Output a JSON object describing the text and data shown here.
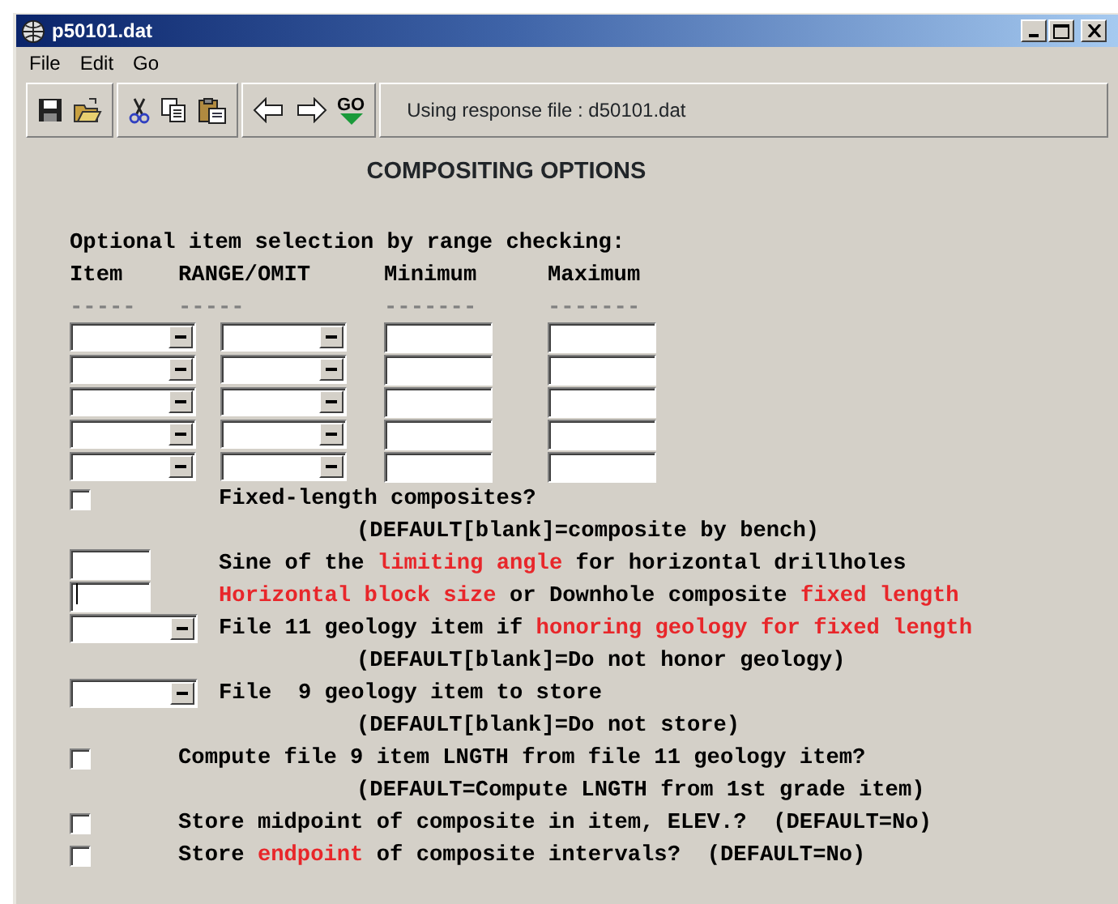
{
  "window": {
    "title": "p50101.dat"
  },
  "menu": [
    {
      "label": "File"
    },
    {
      "label": "Edit"
    },
    {
      "label": "Go"
    }
  ],
  "toolbar": {
    "go_label": "GO",
    "status": "Using response file : d50101.dat"
  },
  "heading": "COMPOSITING OPTIONS",
  "range_section": {
    "title": "Optional item selection by range checking:",
    "columns": [
      {
        "label": "Item",
        "rule": "-----",
        "kind": "dropdown"
      },
      {
        "label": "RANGE/OMIT",
        "rule": "-----",
        "kind": "dropdown"
      },
      {
        "label": "Minimum",
        "rule": "-------",
        "kind": "textbox"
      },
      {
        "label": "Maximum",
        "rule": "-------",
        "kind": "textbox"
      }
    ],
    "rows": [
      {
        "kind": "blank"
      },
      {
        "kind": "blank"
      },
      {
        "kind": "blank"
      },
      {
        "kind": "blank"
      },
      {
        "kind": "blank"
      }
    ]
  },
  "options": [
    {
      "kind": "toggle",
      "checked": false,
      "label": [
        {
          "text": "Fixed-length composites?",
          "highlight": false
        }
      ]
    },
    {
      "kind": "note",
      "text": "(DEFAULT[blank]=composite by bench)"
    },
    {
      "kind": "textbox",
      "focused": false,
      "label": [
        {
          "text": "Sine of the ",
          "highlight": false
        },
        {
          "text": "limiting angle",
          "highlight": true
        },
        {
          "text": " for horizontal drillholes",
          "highlight": false
        }
      ]
    },
    {
      "kind": "textbox",
      "focused": true,
      "label": [
        {
          "text": "Horizontal block size",
          "highlight": true
        },
        {
          "text": " or Downhole composite ",
          "highlight": false
        },
        {
          "text": "fixed length",
          "highlight": true
        }
      ]
    },
    {
      "kind": "dropdown",
      "label": [
        {
          "text": "File 11 geology item if ",
          "highlight": false
        },
        {
          "text": "honoring geology for fixed length",
          "highlight": true
        }
      ]
    },
    {
      "kind": "note",
      "text": "(DEFAULT[blank]=Do not honor geology)"
    },
    {
      "kind": "dropdown",
      "label": [
        {
          "text": "File  9 geology item to store",
          "highlight": false
        }
      ]
    },
    {
      "kind": "note",
      "text": "(DEFAULT[blank]=Do not store)"
    },
    {
      "kind": "checkbox",
      "checked": false,
      "label": [
        {
          "text": "Compute file 9 item LNGTH from file 11 geology item?",
          "highlight": false
        }
      ]
    },
    {
      "kind": "note",
      "text": "(DEFAULT=Compute LNGTH from 1st grade item)"
    },
    {
      "kind": "checkbox",
      "checked": false,
      "label": [
        {
          "text": "Store midpoint of composite in item, ELEV.?  (DEFAULT=No)",
          "highlight": false
        }
      ]
    },
    {
      "kind": "checkbox",
      "checked": false,
      "label": [
        {
          "text": "Store ",
          "highlight": false
        },
        {
          "text": "endpoint",
          "highlight": true
        },
        {
          "text": " of composite intervals?  (DEFAULT=No)",
          "highlight": false
        }
      ]
    }
  ]
}
